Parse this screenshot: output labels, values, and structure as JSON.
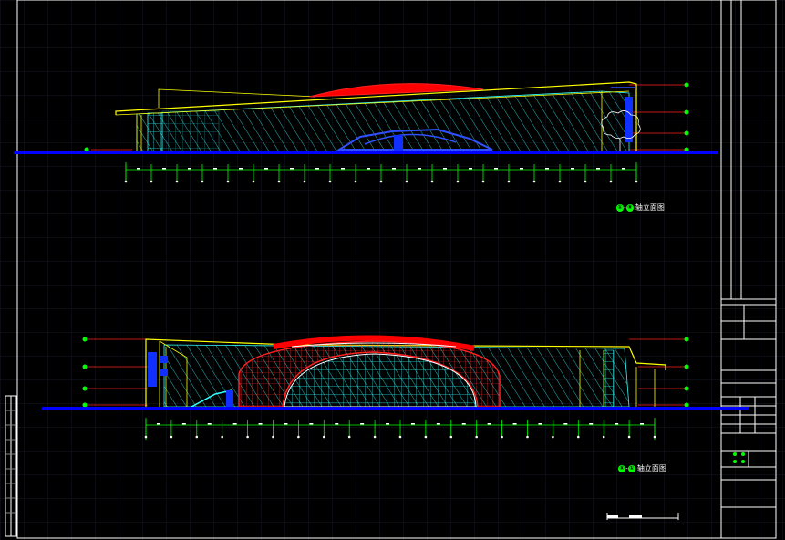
{
  "drawing": {
    "elevation_a": {
      "caption_from": "①",
      "caption_to": "⑧",
      "caption_text": "轴立面图"
    },
    "elevation_b": {
      "caption_from": "⑧",
      "caption_to": "①",
      "caption_text": "轴立面图"
    }
  },
  "colors": {
    "background": "#000000",
    "grid": "#1a1f2a",
    "frame": "#ffffff",
    "ground": "#0000ff",
    "roof_red": "#ff0000",
    "glass_cyan": "#33ffff",
    "outline_yellow": "#ffff00",
    "dimension_green": "#00ff00"
  }
}
